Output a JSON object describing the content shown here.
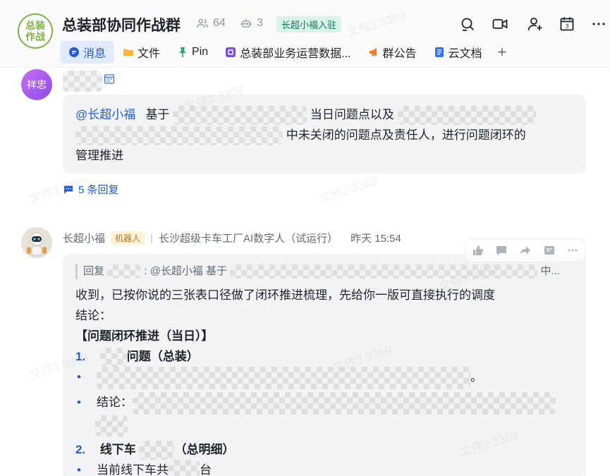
{
  "header": {
    "avatar_text": "总装作战",
    "title": "总装部协同作战群",
    "member_count": "64",
    "bot_count": "3",
    "tag": "长超小福入驻"
  },
  "tabs": [
    {
      "label": "消息",
      "icon": "chat-icon"
    },
    {
      "label": "文件",
      "icon": "folder-icon"
    },
    {
      "label": "Pin",
      "icon": "pin-icon"
    },
    {
      "label": "总装部业务运营数据...",
      "icon": "app-icon"
    },
    {
      "label": "群公告",
      "icon": "megaphone-icon"
    },
    {
      "label": "云文档",
      "icon": "doc-icon"
    }
  ],
  "tab_add": "+",
  "message1": {
    "avatar_text": "祥忠",
    "mention": "@长超小福",
    "text_a": "基于",
    "text_b": "当日问题点以及",
    "text_c": "中未关闭的问题点及责任人，进行问题闭环的",
    "text_d": "管理推进",
    "replies": "5 条回复"
  },
  "message2": {
    "sender": "长超小福",
    "sender_tag": "机器人",
    "org": "长沙超级卡车工厂AI数字人（试运行）",
    "time": "昨天 15:54",
    "quote_prefix": "回复",
    "quote_text": "@长超小福 基于",
    "quote_suffix": "中...",
    "line1": "收到，已按你说的三张表口径做了闭环推进梳理，先给你一版可直接执行的调度",
    "line2": "结论：",
    "section_title": "【问题闭环推进（当日）】",
    "item1_num": "1.",
    "item1_title": "问题（总装）",
    "item1_b2_label": "结论：",
    "period": "。",
    "item2_num": "2.",
    "item2_title_a": "线下车",
    "item2_title_b": "（总明细）",
    "item2_b1_a": "当前线下车共",
    "item2_b1_b": "台"
  },
  "watermark": "文伟3 3369",
  "colors": {
    "accent": "#245bdb",
    "bubble": "#f2f3f5",
    "tag_bg": "#d9f3ea",
    "bot_tag_bg": "#fdf1d6"
  }
}
